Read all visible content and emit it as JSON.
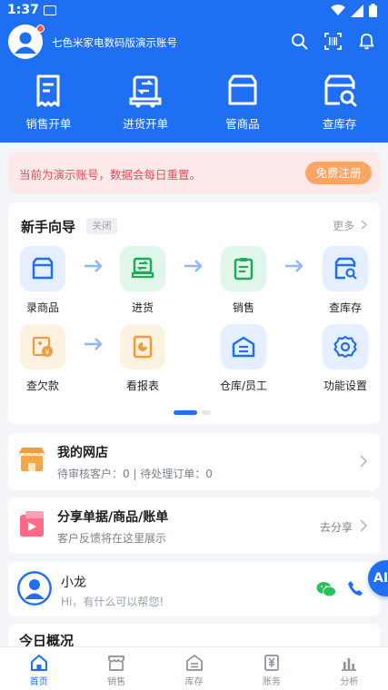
{
  "status_bar": {
    "time": "1:37"
  },
  "header": {
    "account_name": "七色米家电数码版演示账号"
  },
  "quick_actions": [
    {
      "label": "销售开单",
      "icon": "sales-order-icon"
    },
    {
      "label": "进货开单",
      "icon": "purchase-order-icon"
    },
    {
      "label": "管商品",
      "icon": "manage-goods-icon"
    },
    {
      "label": "查库存",
      "icon": "check-stock-icon"
    }
  ],
  "notice": {
    "text": "当前为演示账号，数据会每日重置。",
    "button": "免费注册"
  },
  "guide": {
    "title": "新手向导",
    "close": "关闭",
    "more": "更多",
    "items": [
      {
        "label": "录商品",
        "icon": "box-icon"
      },
      {
        "label": "进货",
        "icon": "truck-icon"
      },
      {
        "label": "销售",
        "icon": "clipboard-icon"
      },
      {
        "label": "查库存",
        "icon": "box-search-icon"
      },
      {
        "label": "查欠款",
        "icon": "debt-icon"
      },
      {
        "label": "看报表",
        "icon": "report-icon"
      },
      {
        "label": "仓库/员工",
        "icon": "warehouse-icon"
      },
      {
        "label": "功能设置",
        "icon": "settings-icon"
      }
    ]
  },
  "shop": {
    "title": "我的网店",
    "subtitle": "待审核客户：0 | 待处理订单：0"
  },
  "share": {
    "title": "分享单据/商品/账单",
    "subtitle": "客户反馈将在这里展示",
    "action": "去分享"
  },
  "service": {
    "name": "小龙",
    "message": "Hi，有什么可以帮您!",
    "ai_label": "AI"
  },
  "overview": {
    "title": "今日概况"
  },
  "colors": {
    "primary": "#1f6ff2",
    "notice_bg": "#fde8ea",
    "notice_text": "#e84c56",
    "register_button": "#f8a565"
  },
  "tabs": [
    {
      "label": "首页",
      "active": true
    },
    {
      "label": "销售",
      "active": false
    },
    {
      "label": "库存",
      "active": false
    },
    {
      "label": "账务",
      "active": false
    },
    {
      "label": "分析",
      "active": false
    }
  ]
}
